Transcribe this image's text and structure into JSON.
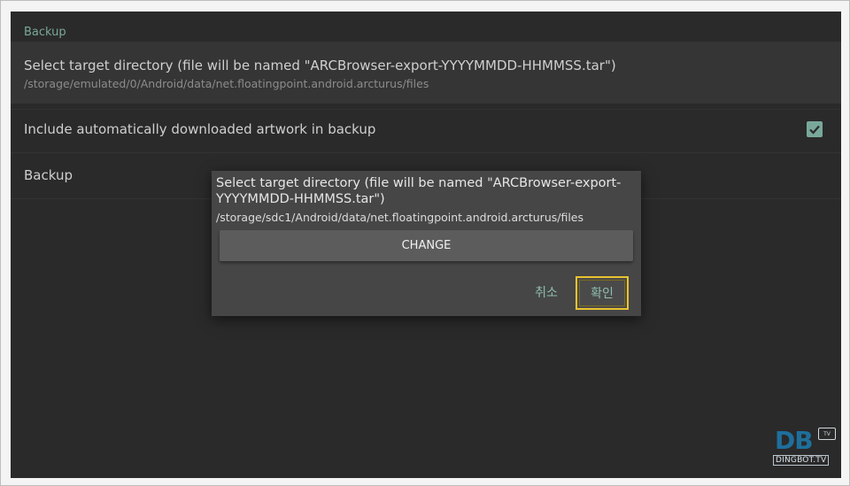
{
  "settings": {
    "section_header": "Backup",
    "target_dir": {
      "title": "Select target directory (file will be named \"ARCBrowser-export-YYYYMMDD-HHMMSS.tar\")",
      "summary": "/storage/emulated/0/Android/data/net.floatingpoint.android.arcturus/files"
    },
    "include_artwork": {
      "title": "Include automatically downloaded artwork in backup",
      "checked": true
    },
    "backup": {
      "title": "Backup"
    }
  },
  "dialog": {
    "message": "Select target directory (file will be named \"ARCBrowser-export-YYYYMMDD-HHMMSS.tar\")",
    "path": "/storage/sdc1/Android/data/net.floatingpoint.android.arcturus/files",
    "change_label": "CHANGE",
    "cancel_label": "취소",
    "ok_label": "확인"
  },
  "watermark": {
    "logo_text": "DB",
    "badge_text": "TV",
    "site": "DINGBOT.TV"
  },
  "colors": {
    "accent": "#79a89a",
    "focus": "#e9c330",
    "background": "#2a2a2a",
    "dialog": "#464646"
  },
  "icons": {
    "checkbox": "checkmark-icon"
  }
}
